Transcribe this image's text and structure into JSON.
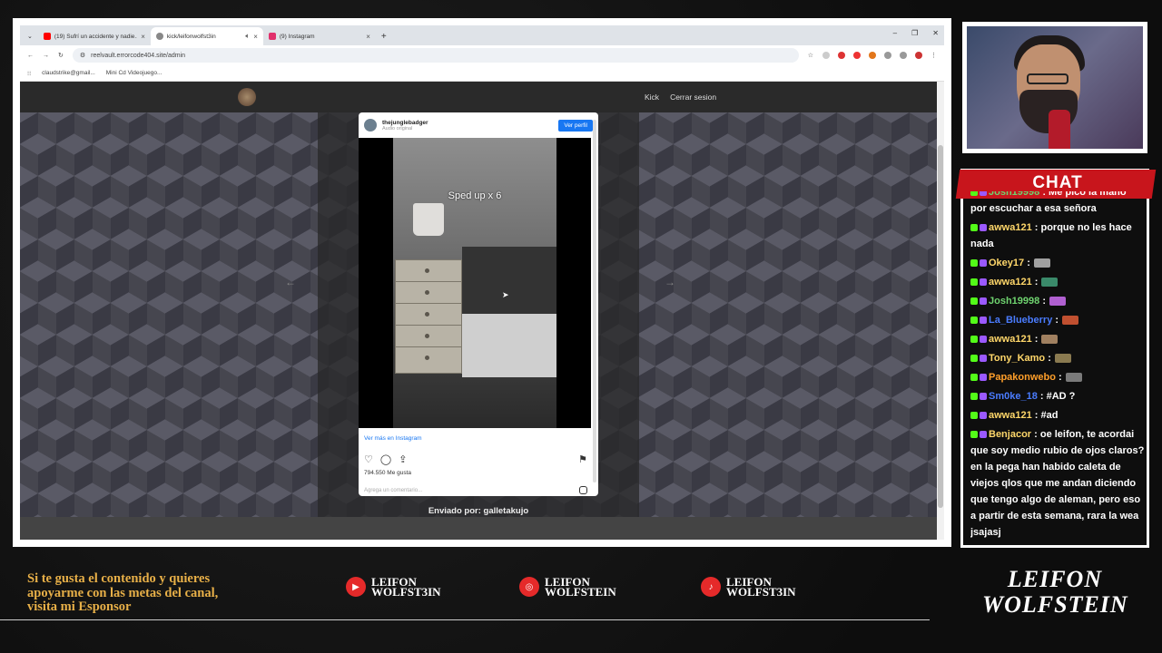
{
  "browser": {
    "tabs": [
      {
        "title": "(19) Sufrí un accidente y nadie...",
        "icon_color": "#ff0000"
      },
      {
        "title": "kick/leifonwolfst3in",
        "icon_color": "#888888",
        "active": true
      },
      {
        "title": "(9) Instagram",
        "icon_color": "#e1306c"
      }
    ],
    "plus": "+",
    "url": "reelvault.errorcode404.site/admin",
    "bookmarks": [
      "claudstrike@gmail...",
      "Mini Cd Videojuego..."
    ]
  },
  "site": {
    "nav_links": [
      "Kick",
      "Cerrar sesion"
    ],
    "prev_arrow": "←",
    "next_arrow": "→",
    "sent_by": "Enviado por: galletakujo"
  },
  "instagram": {
    "username": "thejunglebadger",
    "subtitle": "Audio original",
    "view_profile": "Ver perfil",
    "video_text": "Sped up x 6",
    "see_more": "Ver más en Instagram",
    "likes": "794.550 Me gusta",
    "comment_placeholder": "Agrega un comentario..."
  },
  "chat": {
    "title": "CHAT",
    "messages": [
      {
        "user": "Josh19998",
        "color": "#6fd36f",
        "text": ": Me picó la mano por escuchar a esa señora"
      },
      {
        "user": "awwa121",
        "color": "#ffd76a",
        "text": ": porque no les hace nada"
      },
      {
        "user": "Okey17",
        "color": "#ffd76a",
        "text": ":"
      },
      {
        "user": "awwa121",
        "color": "#ffd76a",
        "text": ":"
      },
      {
        "user": "Josh19998",
        "color": "#6fd36f",
        "text": ":"
      },
      {
        "user": "La_Blueberry",
        "color": "#4a7cff",
        "text": ":"
      },
      {
        "user": "awwa121",
        "color": "#ffd76a",
        "text": ":"
      },
      {
        "user": "Tony_Kamo",
        "color": "#ffd76a",
        "text": ":"
      },
      {
        "user": "Papakonwebo",
        "color": "#ff9f2a",
        "text": ":"
      },
      {
        "user": "Sm0ke_18",
        "color": "#4a7cff",
        "text": ": #AD ?"
      },
      {
        "user": "awwa121",
        "color": "#ffd76a",
        "text": ": #ad"
      },
      {
        "user": "Benjacor",
        "color": "#ffd76a",
        "text": ": oe leifon, te acordai que soy medio rubio de ojos claros? en la pega han habido caleta de viejos qlos que me andan diciendo que tengo algo de aleman, pero eso a partir de esta semana, rara la wea jsajasj"
      }
    ]
  },
  "footer": {
    "promo_line1": "Si te gusta el contenido y quieres",
    "promo_line2": "apoyarme con las metas del canal,",
    "promo_line3": "visita mi Esponsor",
    "socials": [
      {
        "icon": "youtube-icon",
        "line1": "LEIFON",
        "line2": "WOLFST3IN"
      },
      {
        "icon": "instagram-icon",
        "line1": "LEIFON",
        "line2": "WOLFSTEIN"
      },
      {
        "icon": "tiktok-icon",
        "line1": "LEIFON",
        "line2": "WOLFST3IN"
      }
    ],
    "logo_line1": "LEIFON",
    "logo_line2": "WOLFSTEIN"
  }
}
